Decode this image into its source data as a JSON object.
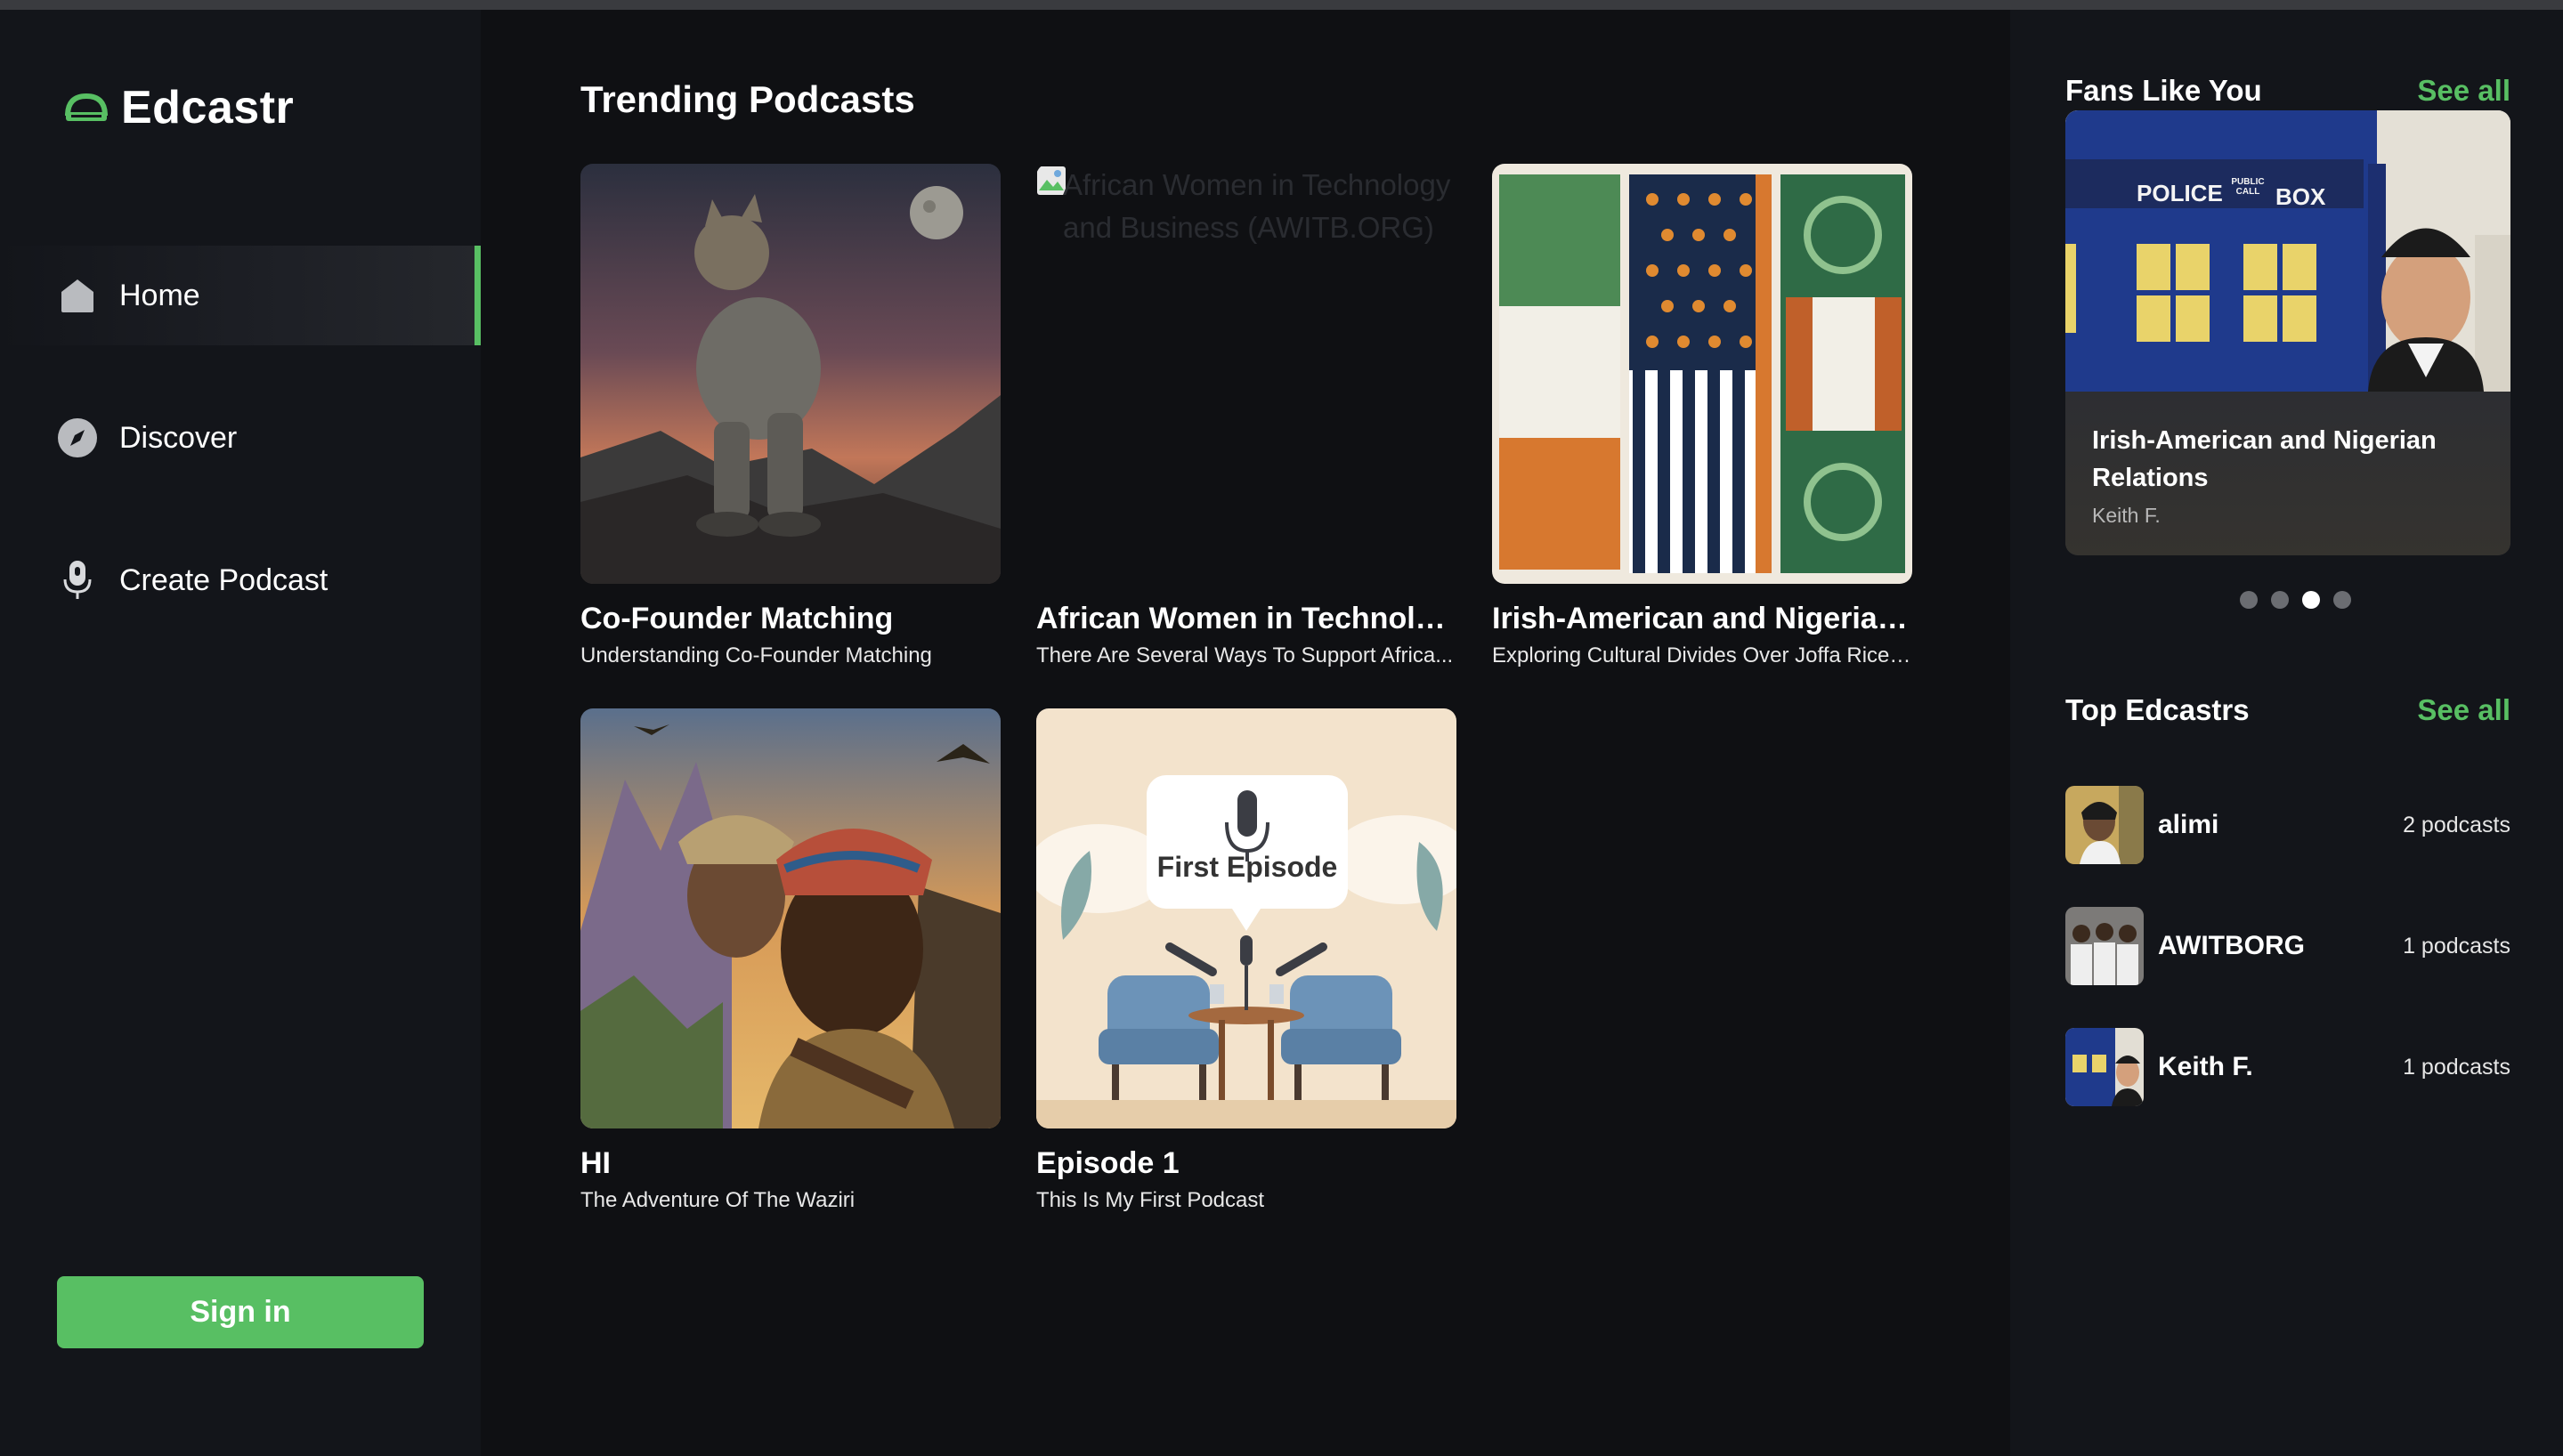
{
  "app": {
    "name": "Edcastr"
  },
  "sidebar": {
    "items": [
      {
        "label": "Home",
        "icon": "home-icon",
        "active": true
      },
      {
        "label": "Discover",
        "icon": "compass-icon"
      },
      {
        "label": "Create Podcast",
        "icon": "microphone-icon"
      }
    ],
    "signin_label": "Sign in"
  },
  "main": {
    "title": "Trending Podcasts",
    "podcasts": [
      {
        "title": "Co-Founder Matching",
        "subtitle": "Understanding Co-Founder Matching"
      },
      {
        "title": "African Women in Technolog...",
        "subtitle": "There Are Several Ways To Support Africa...",
        "image_alt": "African Women in Technology and Business (AWITB.ORG)"
      },
      {
        "title": "Irish-American and Nigerian ...",
        "subtitle": "Exploring Cultural Divides Over Joffa Rice ..."
      },
      {
        "title": "HI",
        "subtitle": "The Adventure Of The Waziri"
      },
      {
        "title": "Episode 1",
        "subtitle": "This Is My First Podcast",
        "image_text": "First Episode"
      }
    ]
  },
  "right": {
    "fans": {
      "title": "Fans Like You",
      "see_all": "See all",
      "card": {
        "title": "Irish-American and Nigerian Relations",
        "author": "Keith F.",
        "photo_sign_1": "POLICE",
        "photo_sign_2": "PUBLIC CALL",
        "photo_sign_3": "BOX"
      },
      "dots": 4,
      "active_dot": 3
    },
    "top": {
      "title": "Top Edcastrs",
      "see_all": "See all",
      "items": [
        {
          "name": "alimi",
          "count": "2 podcasts"
        },
        {
          "name": "AWITBORG",
          "count": "1 podcasts"
        },
        {
          "name": "Keith F.",
          "count": "1 podcasts"
        }
      ]
    }
  },
  "colors": {
    "accent": "#58bf63",
    "background": "#0f1013",
    "sidebar": "#13151a"
  }
}
